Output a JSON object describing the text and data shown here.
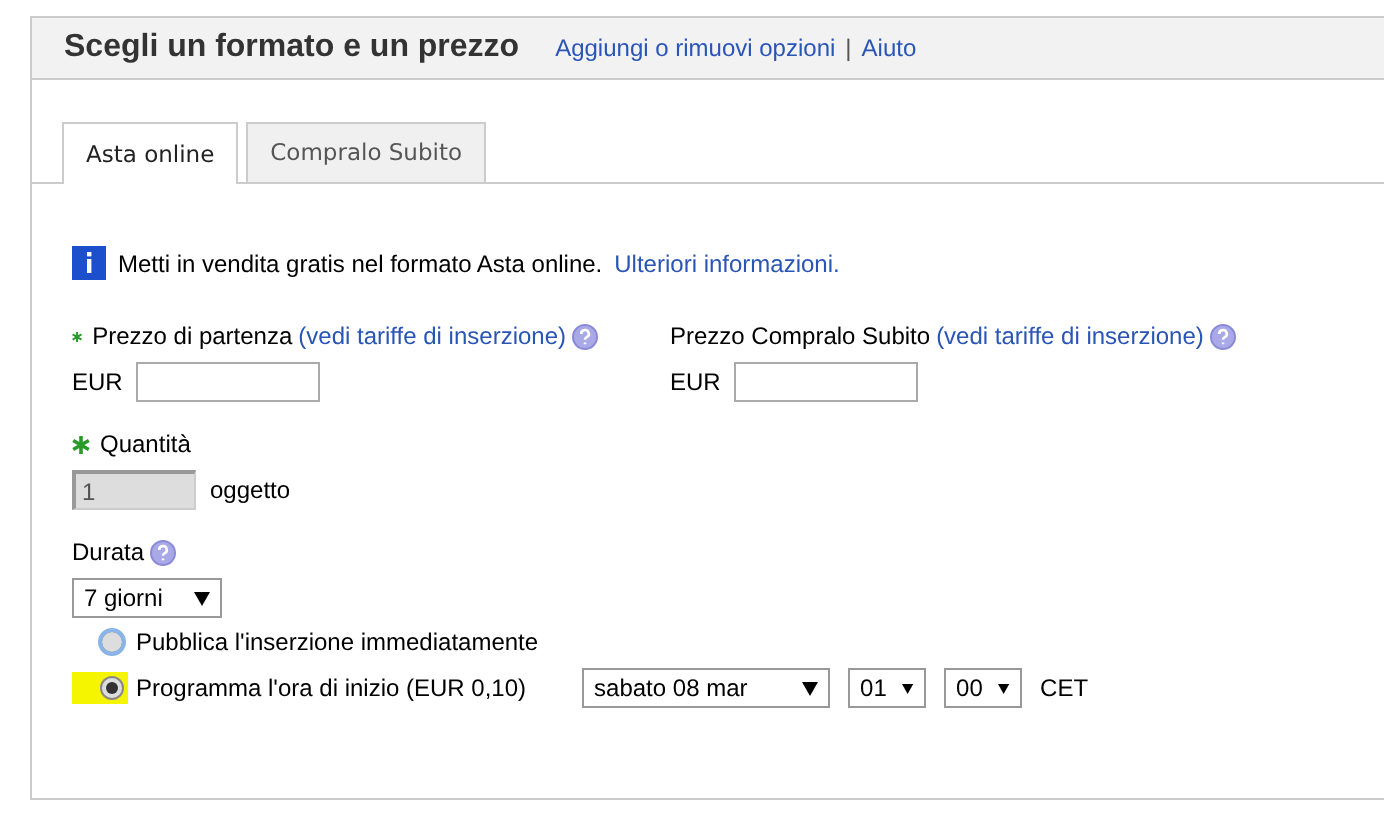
{
  "header": {
    "title": "Scegli un formato e un prezzo",
    "links": [
      "Aggiungi o rimuovi opzioni",
      "Aiuto"
    ],
    "separator": "|"
  },
  "tabs": [
    {
      "label": "Asta online",
      "selected": true
    },
    {
      "label": "Compralo Subito",
      "selected": false
    }
  ],
  "info": {
    "text": "Metti in vendita gratis nel formato Asta online.",
    "link": "Ulteriori informazioni."
  },
  "prices": [
    {
      "required": true,
      "label": "Prezzo di partenza",
      "link": "(vedi tariffe di inserzione)",
      "currency": "EUR"
    },
    {
      "required": false,
      "label": "Prezzo Compralo Subito",
      "link": "(vedi tariffe di inserzione)",
      "currency": "EUR"
    }
  ],
  "quantity": {
    "required": true,
    "label": "Quantità",
    "value": "1",
    "unit": "oggetto",
    "disabled": true
  },
  "duration": {
    "label": "Durata",
    "value": "7 giorni"
  },
  "start_options": [
    {
      "label": "Pubblica l'inserzione immediatamente",
      "selected": false
    },
    {
      "label": "Programma l'ora di inizio (EUR 0,10)",
      "selected": true
    }
  ],
  "schedule": {
    "date": "sabato 08 mar",
    "hour": "01",
    "minute": "00",
    "timezone": "CET"
  }
}
